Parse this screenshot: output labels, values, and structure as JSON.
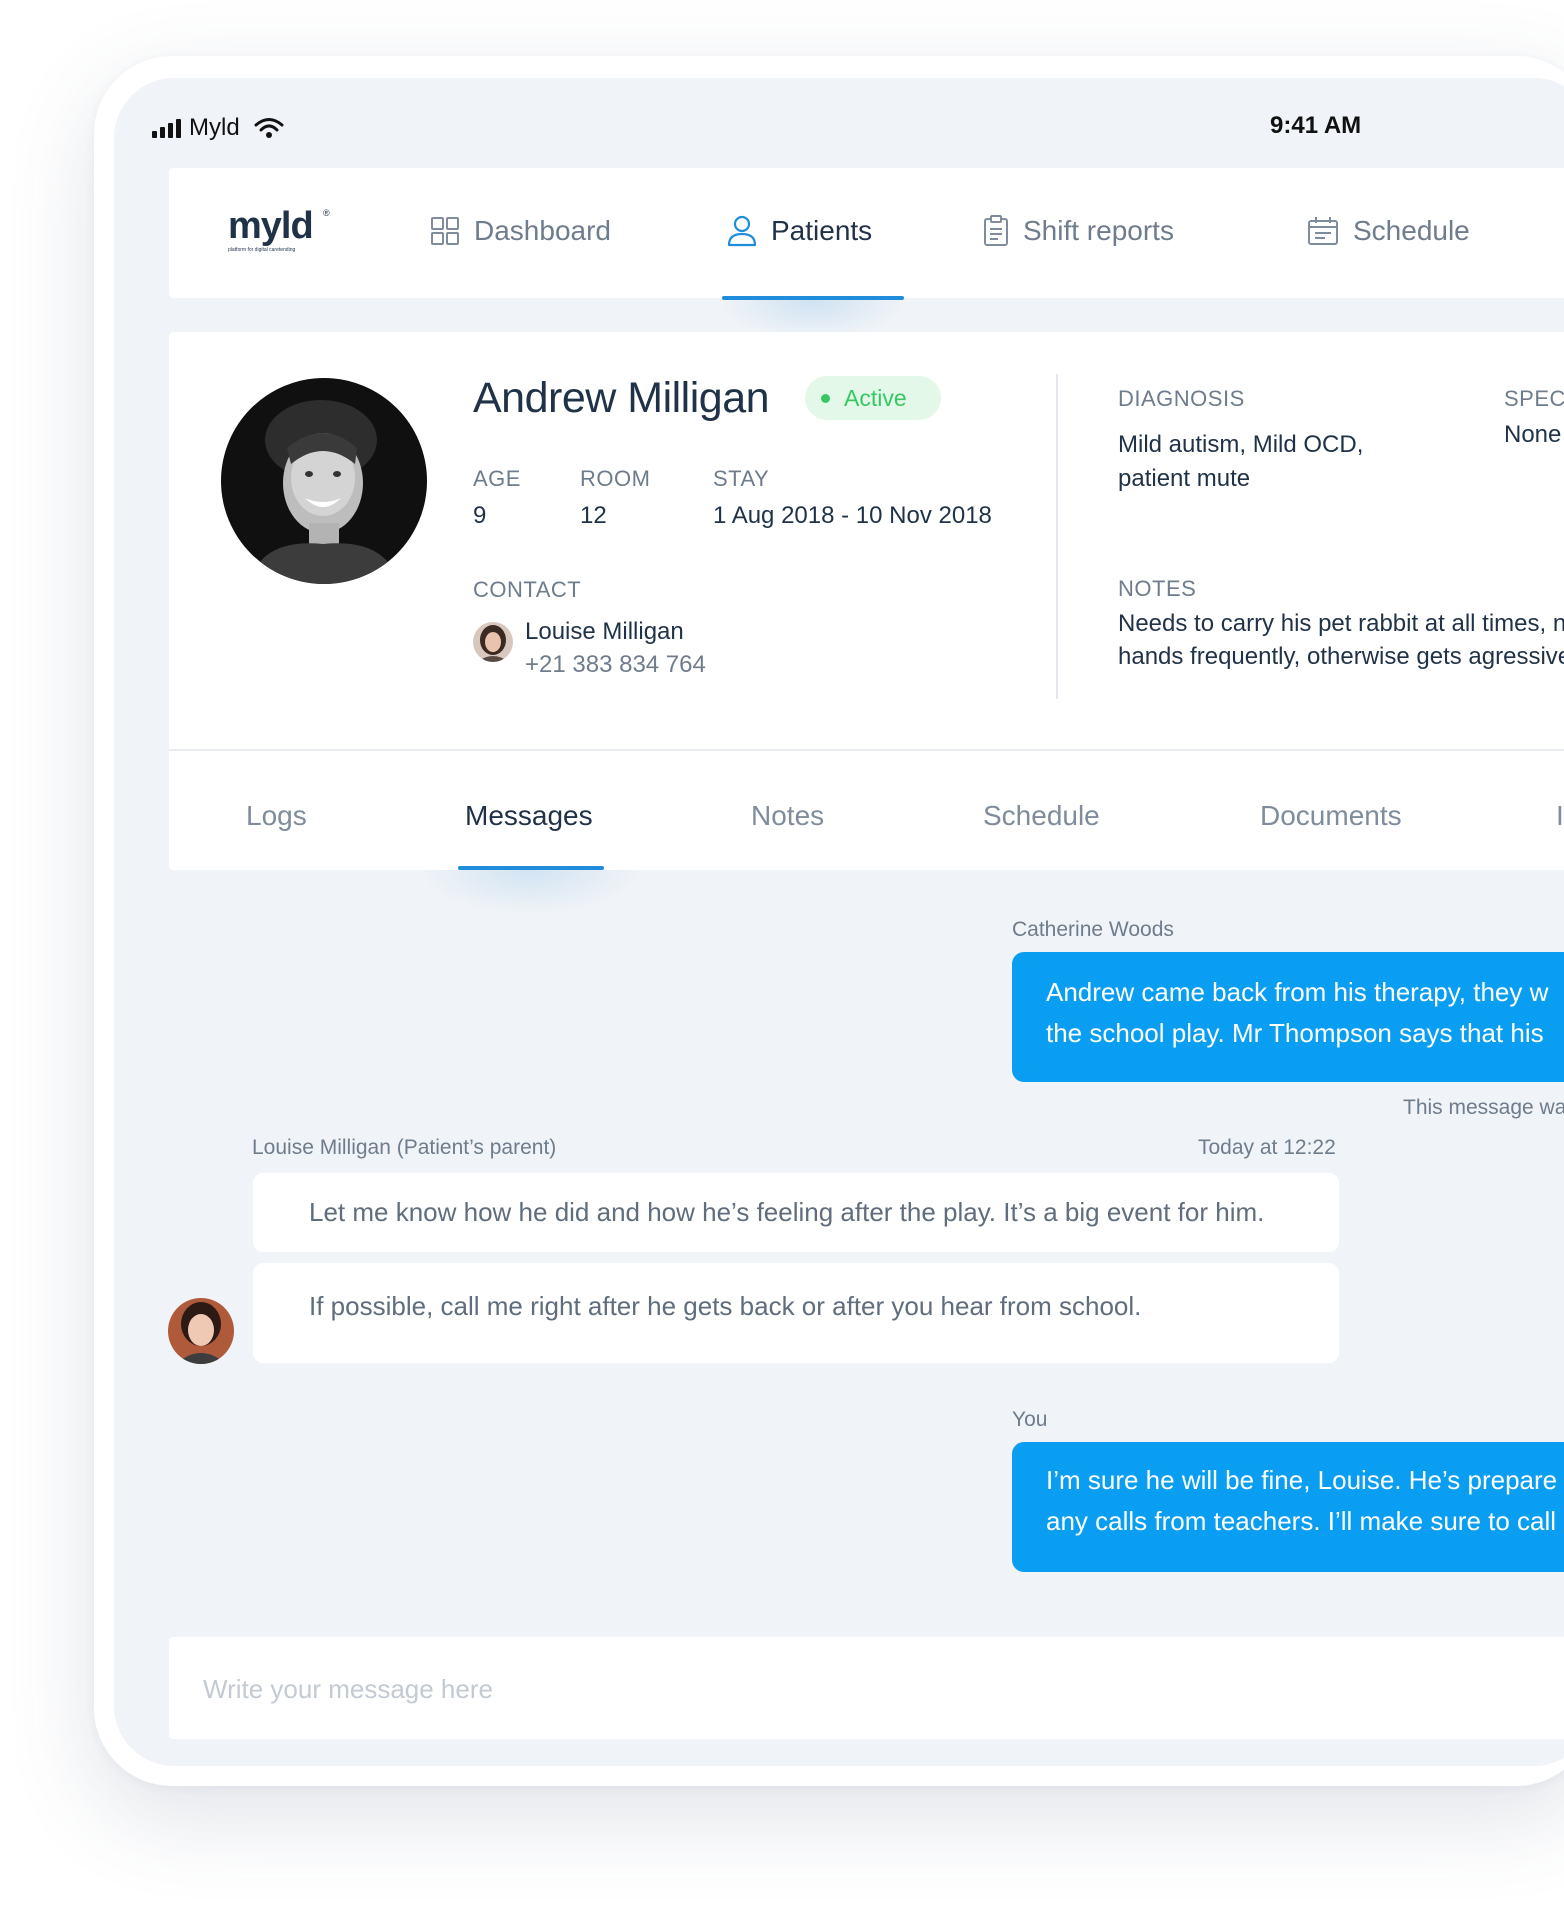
{
  "status_bar": {
    "carrier": "Myld",
    "time": "9:41 AM"
  },
  "nav": {
    "logo_text": "myld",
    "logo_tagline": "platform for digital caretending",
    "items": [
      {
        "label": "Dashboard",
        "icon": "grid-icon",
        "active": false
      },
      {
        "label": "Patients",
        "icon": "user-icon",
        "active": true
      },
      {
        "label": "Shift reports",
        "icon": "clipboard-icon",
        "active": false
      },
      {
        "label": "Schedule",
        "icon": "calendar-icon",
        "active": false
      }
    ]
  },
  "patient": {
    "name": "Andrew Milligan",
    "status": "Active",
    "age_label": "AGE",
    "age": "9",
    "room_label": "ROOM",
    "room": "12",
    "stay_label": "STAY",
    "stay": "1 Aug 2018 - 10 Nov 2018",
    "contact_label": "CONTACT",
    "contact_name": "Louise Milligan",
    "contact_phone": "+21 383 834 764",
    "diagnosis_label": "DIAGNOSIS",
    "diagnosis_line1": "Mild autism, Mild OCD,",
    "diagnosis_line2": "patient mute",
    "special_label": "SPEC",
    "special_value": "None",
    "notes_label": "NOTES",
    "notes_line1": "Needs to carry his pet rabbit at all times, ne",
    "notes_line2": "hands frequently, otherwise gets agressive"
  },
  "tabs": [
    {
      "label": "Logs",
      "active": false
    },
    {
      "label": "Messages",
      "active": true
    },
    {
      "label": "Notes",
      "active": false
    },
    {
      "label": "Schedule",
      "active": false
    },
    {
      "label": "Documents",
      "active": false
    },
    {
      "label": "I",
      "active": false
    }
  ],
  "messages": {
    "msg1_author": "Catherine Woods",
    "msg1_line1": "Andrew came back from his therapy, they w",
    "msg1_line2": "the school play. Mr Thompson says that his",
    "msg1_footer": "This message wa",
    "msg2_author": "Louise Milligan (Patient’s parent)",
    "msg2_time": "Today at 12:22",
    "msg2_text1": "Let me know how he did and how he’s feeling after the play. It’s a big event for him.",
    "msg2_text2": "If possible, call me right after he gets back or after you hear from school.",
    "msg3_author": "You",
    "msg3_line1": "I’m sure he will be fine, Louise. He’s prepare",
    "msg3_line2": "any calls from teachers. I’ll make sure to call"
  },
  "composer": {
    "placeholder": "Write your message here"
  },
  "colors": {
    "accent": "#1f8ddb",
    "bubble_blue": "#0a9ef3",
    "active_badge_bg": "#e3f8e8",
    "active_badge_text": "#37c864",
    "background": "#f0f3f7"
  }
}
